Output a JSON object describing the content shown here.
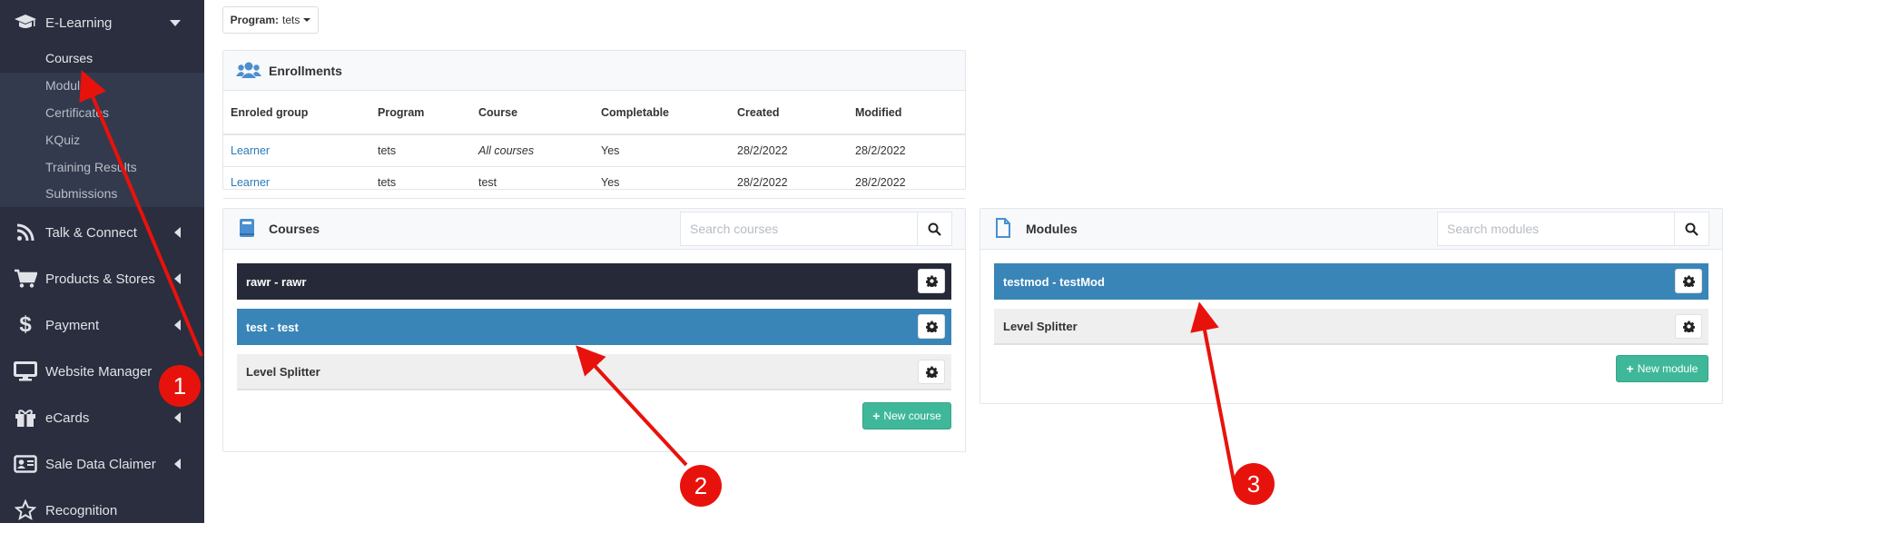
{
  "sidebar": {
    "items": [
      {
        "label": "E-Learning",
        "icon": "graduation-cap-icon",
        "expanded": true
      },
      {
        "label": "Talk & Connect",
        "icon": "rss-icon"
      },
      {
        "label": "Products & Stores",
        "icon": "shopping-cart-icon"
      },
      {
        "label": "Payment",
        "icon": "dollar-icon"
      },
      {
        "label": "Website Manager",
        "icon": "desktop-icon"
      },
      {
        "label": "eCards",
        "icon": "gift-icon"
      },
      {
        "label": "Sale Data Claimer",
        "icon": "id-card-icon"
      },
      {
        "label": "Recognition",
        "icon": "star-icon"
      }
    ],
    "submenu": [
      {
        "label": "Courses",
        "active": true
      },
      {
        "label": "Modules"
      },
      {
        "label": "Certificates"
      },
      {
        "label": "KQuiz"
      },
      {
        "label": "Training Results"
      },
      {
        "label": "Submissions"
      }
    ]
  },
  "program": {
    "label": "Program:",
    "value": "tets"
  },
  "enrollments": {
    "title": "Enrollments",
    "columns": [
      "Enroled group",
      "Program",
      "Course",
      "Completable",
      "Created",
      "Modified"
    ],
    "rows": [
      [
        "Learner",
        "tets",
        "All courses",
        "Yes",
        "28/2/2022",
        "28/2/2022"
      ],
      [
        "Learner",
        "tets",
        "test",
        "Yes",
        "28/2/2022",
        "28/2/2022"
      ]
    ]
  },
  "courses": {
    "title": "Courses",
    "search_placeholder": "Search courses",
    "items": [
      "rawr - rawr",
      "test - test",
      "Level Splitter"
    ],
    "new_label": "New course"
  },
  "modules": {
    "title": "Modules",
    "search_placeholder": "Search modules",
    "items": [
      "testmod - testMod",
      "Level Splitter"
    ],
    "new_label": "New module"
  },
  "annotations": [
    "1",
    "2",
    "3"
  ],
  "colors": {
    "sidebar": "#2a2e3e",
    "submenu": "#343a4d",
    "active_row": "#3a85b8",
    "dark_row": "#262a38",
    "new_button": "#3fb89a",
    "annotation": "#e8120c"
  }
}
